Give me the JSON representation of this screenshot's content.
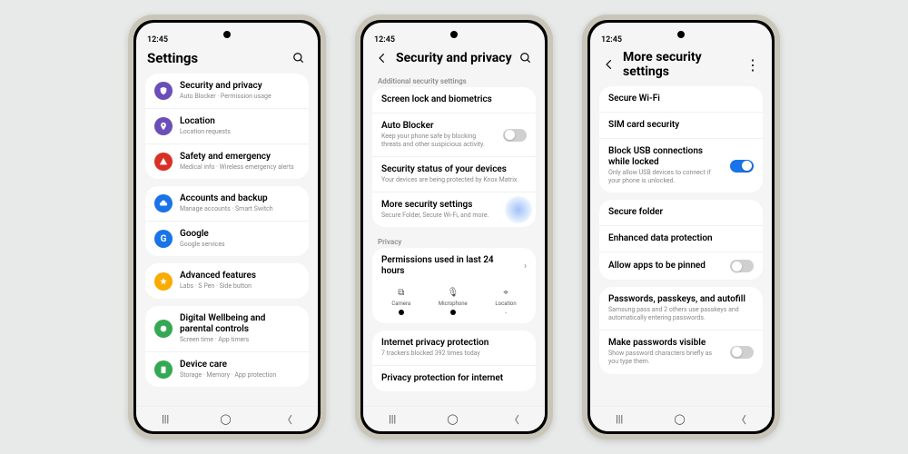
{
  "status_time": "12:45",
  "p1": {
    "title": "Settings",
    "groups": [
      {
        "rows": [
          {
            "icon": "shield",
            "color": "#6a4fb8",
            "title": "Security and privacy",
            "sub": "Auto Blocker · Permission usage"
          },
          {
            "icon": "pin",
            "color": "#6a4fb8",
            "title": "Location",
            "sub": "Location requests"
          },
          {
            "icon": "alert",
            "color": "#d93025",
            "title": "Safety and emergency",
            "sub": "Medical info · Wireless emergency alerts"
          }
        ]
      },
      {
        "rows": [
          {
            "icon": "cloud",
            "color": "#1a73e8",
            "title": "Accounts and backup",
            "sub": "Manage accounts · Smart Switch"
          },
          {
            "icon": "g",
            "color": "#1a73e8",
            "title": "Google",
            "sub": "Google services"
          }
        ]
      },
      {
        "rows": [
          {
            "icon": "star",
            "color": "#f9ab00",
            "title": "Advanced features",
            "sub": "Labs · S Pen · Side button"
          }
        ]
      },
      {
        "rows": [
          {
            "icon": "well",
            "color": "#34a853",
            "title": "Digital Wellbeing and parental controls",
            "sub": "Screen time · App timers"
          },
          {
            "icon": "battery",
            "color": "#34a853",
            "title": "Device care",
            "sub": "Storage · Memory · App protection"
          }
        ]
      }
    ]
  },
  "p2": {
    "title": "Security and privacy",
    "section1_label": "Additional security settings",
    "rows1": [
      {
        "title": "Screen lock and biometrics"
      },
      {
        "title": "Auto Blocker",
        "sub": "Keep your phone safe by blocking threats and other suspicious activity.",
        "toggle": "off"
      },
      {
        "title": "Security status of your devices",
        "sub": "Your devices are being protected by Knox Matrix."
      },
      {
        "title": "More security settings",
        "sub": "Secure Folder, Secure Wi-Fi, and more.",
        "highlight": true
      }
    ],
    "section2_label": "Privacy",
    "perm_title": "Permissions used in last 24 hours",
    "perms": [
      {
        "label": "Camera",
        "dot": true
      },
      {
        "label": "Microphone",
        "dot": true
      },
      {
        "label": "Location",
        "dot": false,
        "val": "-"
      }
    ],
    "rows3": [
      {
        "title": "Internet privacy protection",
        "sub": "7 trackers blocked 392 times today"
      },
      {
        "title": "Privacy protection for internet"
      }
    ]
  },
  "p3": {
    "title": "More security settings",
    "groups": [
      {
        "rows": [
          {
            "title": "Secure Wi-Fi"
          },
          {
            "title": "SIM card security"
          },
          {
            "title": "Block USB connections while locked",
            "sub": "Only allow USB devices to connect if your phone is unlocked.",
            "toggle": "on"
          }
        ]
      },
      {
        "rows": [
          {
            "title": "Secure folder"
          },
          {
            "title": "Enhanced data protection"
          },
          {
            "title": "Allow apps to be pinned",
            "toggle": "off"
          }
        ]
      },
      {
        "rows": [
          {
            "title": "Passwords, passkeys, and autofill",
            "sub": "Samsung pass and 2 others use passkeys and automatically entering passwords."
          },
          {
            "title": "Make passwords visible",
            "sub": "Show password characters briefly as you type them.",
            "toggle": "off"
          }
        ]
      }
    ]
  }
}
